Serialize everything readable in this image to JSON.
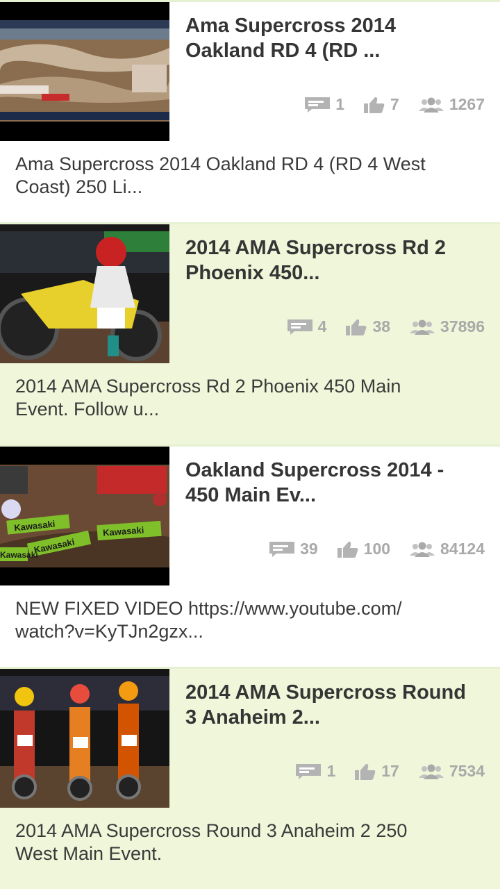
{
  "videos": [
    {
      "title": "Ama Supercross 2014\nOakland RD 4 (RD ...",
      "comments": "1",
      "likes": "7",
      "views": "1267",
      "description": "Ama Supercross 2014 Oakland RD 4 (RD 4 West\nCoast) 250 Li..."
    },
    {
      "title": "2014 AMA Supercross Rd 2\nPhoenix 450...",
      "comments": "4",
      "likes": "38",
      "views": "37896",
      "description": "2014 AMA Supercross Rd 2 Phoenix 450 Main\nEvent. Follow u..."
    },
    {
      "title": "Oakland Supercross 2014 -\n450 Main Ev...",
      "comments": "39",
      "likes": "100",
      "views": "84124",
      "description": "NEW FIXED VIDEO https://www.youtube.com/\nwatch?v=KyTJn2gzx..."
    },
    {
      "title": "2014 AMA Supercross Round\n3 Anaheim 2...",
      "comments": "1",
      "likes": "17",
      "views": "7534",
      "description": "2014 AMA Supercross Round 3 Anaheim 2 250\nWest Main Event."
    }
  ],
  "thumbnail_banners": [
    "Kawasaki",
    "Kawasaki",
    "Kawasaki",
    "Kawasaki"
  ],
  "icons": {
    "comments": "comment-icon",
    "likes": "thumbs-up-icon",
    "views": "viewers-icon"
  },
  "colors": {
    "title": "#353535",
    "description": "#3a3a3a",
    "stats": "#a9a9a9",
    "card_white": "#ffffff",
    "card_green": "#eff6d9",
    "divider": "#e6f0d2"
  }
}
